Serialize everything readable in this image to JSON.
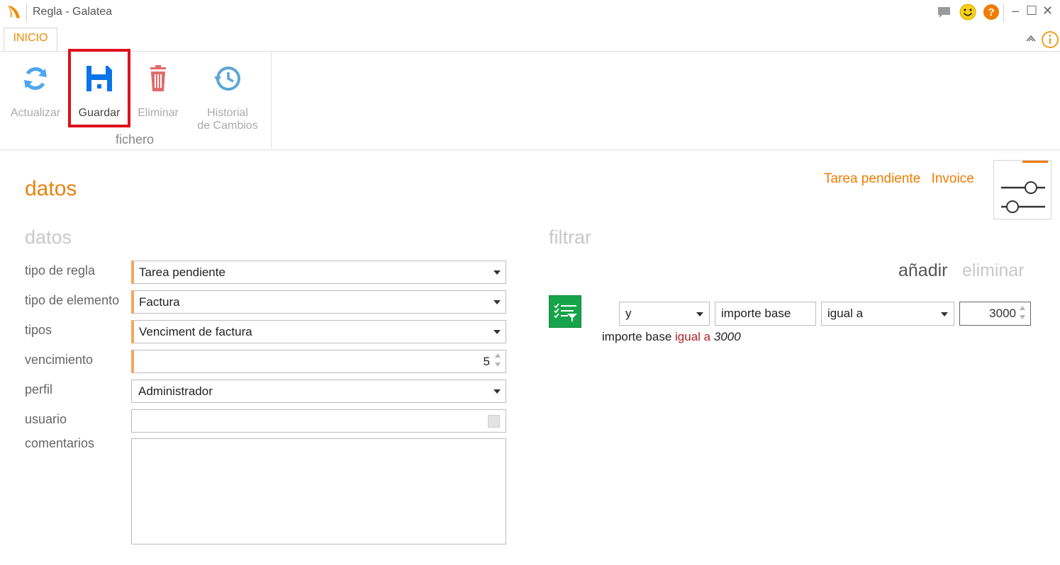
{
  "window": {
    "title": "Regla - Galatea",
    "icons": [
      "app-logo",
      "chat-icon",
      "smiley-icon",
      "help-icon"
    ],
    "buttons": {
      "minimize": "–",
      "maximize": "☐",
      "close": "✕"
    }
  },
  "ribbon": {
    "tab": "INICIO",
    "buttons": [
      {
        "label": "Actualizar",
        "state": "disabled",
        "icon": "refresh-icon"
      },
      {
        "label": "Guardar",
        "state": "enabled",
        "icon": "save-icon",
        "highlighted": true
      },
      {
        "label": "Eliminar",
        "state": "disabled",
        "icon": "trash-icon"
      },
      {
        "label_line1": "Historial",
        "label_line2": "de Cambios",
        "state": "disabled",
        "icon": "history-icon"
      }
    ],
    "group_label": "fichero"
  },
  "page": {
    "title": "datos",
    "tags": [
      "Tarea pendiente",
      "Invoice"
    ]
  },
  "datos": {
    "section_title": "datos",
    "fields": {
      "tipo_regla": {
        "label": "tipo de regla",
        "value": "Tarea pendiente"
      },
      "tipo_elemento": {
        "label": "tipo de elemento",
        "value": "Factura"
      },
      "tipos": {
        "label": "tipos",
        "value": "Venciment de factura"
      },
      "vencimiento": {
        "label": "vencimiento",
        "value": "5"
      },
      "perfil": {
        "label": "perfil",
        "value": "Administrador"
      },
      "usuario": {
        "label": "usuario",
        "value": ""
      },
      "comentarios": {
        "label": "comentarios",
        "value": ""
      }
    }
  },
  "filtrar": {
    "section_title": "filtrar",
    "add_label": "añadir",
    "remove_label": "eliminar",
    "condition": {
      "connector": "y",
      "field": "importe base",
      "operator": "igual a",
      "value": "3000"
    },
    "summary": {
      "field": "importe base",
      "operator": "igual a",
      "value": "3000"
    }
  },
  "colors": {
    "accent": "#f08a00",
    "highlight_border": "#e0101c",
    "save_icon": "#0a74e8",
    "filter_button": "#17a349"
  }
}
